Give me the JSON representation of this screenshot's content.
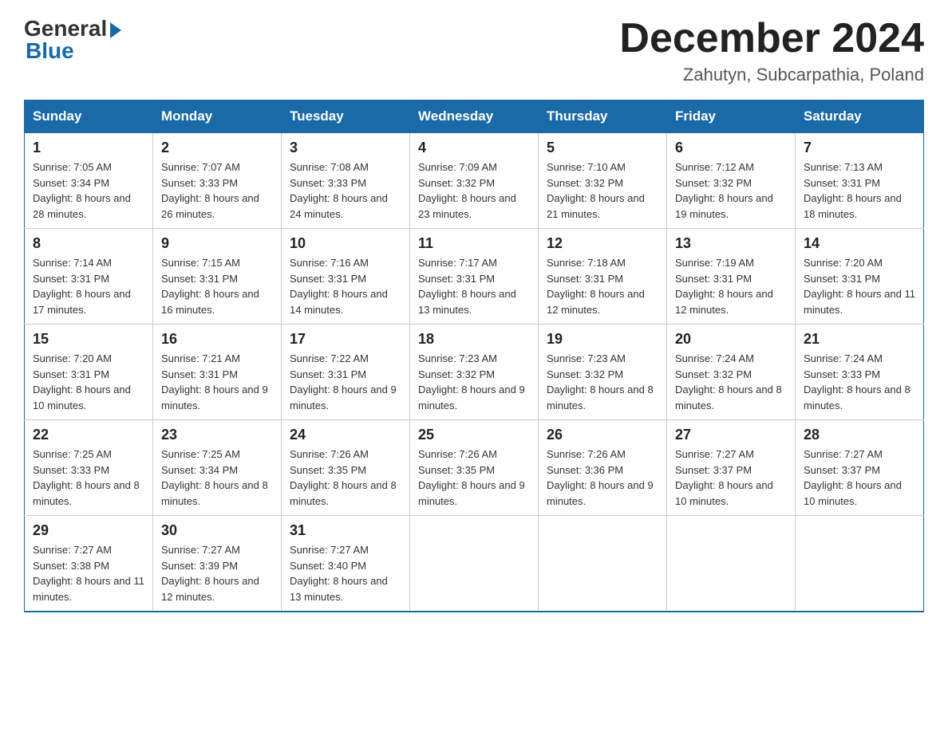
{
  "header": {
    "logo": {
      "general": "General",
      "blue": "Blue"
    },
    "title": "December 2024",
    "location": "Zahutyn, Subcarpathia, Poland"
  },
  "days_of_week": [
    "Sunday",
    "Monday",
    "Tuesday",
    "Wednesday",
    "Thursday",
    "Friday",
    "Saturday"
  ],
  "weeks": [
    [
      {
        "day": "1",
        "sunrise": "7:05 AM",
        "sunset": "3:34 PM",
        "daylight": "8 hours and 28 minutes."
      },
      {
        "day": "2",
        "sunrise": "7:07 AM",
        "sunset": "3:33 PM",
        "daylight": "8 hours and 26 minutes."
      },
      {
        "day": "3",
        "sunrise": "7:08 AM",
        "sunset": "3:33 PM",
        "daylight": "8 hours and 24 minutes."
      },
      {
        "day": "4",
        "sunrise": "7:09 AM",
        "sunset": "3:32 PM",
        "daylight": "8 hours and 23 minutes."
      },
      {
        "day": "5",
        "sunrise": "7:10 AM",
        "sunset": "3:32 PM",
        "daylight": "8 hours and 21 minutes."
      },
      {
        "day": "6",
        "sunrise": "7:12 AM",
        "sunset": "3:32 PM",
        "daylight": "8 hours and 19 minutes."
      },
      {
        "day": "7",
        "sunrise": "7:13 AM",
        "sunset": "3:31 PM",
        "daylight": "8 hours and 18 minutes."
      }
    ],
    [
      {
        "day": "8",
        "sunrise": "7:14 AM",
        "sunset": "3:31 PM",
        "daylight": "8 hours and 17 minutes."
      },
      {
        "day": "9",
        "sunrise": "7:15 AM",
        "sunset": "3:31 PM",
        "daylight": "8 hours and 16 minutes."
      },
      {
        "day": "10",
        "sunrise": "7:16 AM",
        "sunset": "3:31 PM",
        "daylight": "8 hours and 14 minutes."
      },
      {
        "day": "11",
        "sunrise": "7:17 AM",
        "sunset": "3:31 PM",
        "daylight": "8 hours and 13 minutes."
      },
      {
        "day": "12",
        "sunrise": "7:18 AM",
        "sunset": "3:31 PM",
        "daylight": "8 hours and 12 minutes."
      },
      {
        "day": "13",
        "sunrise": "7:19 AM",
        "sunset": "3:31 PM",
        "daylight": "8 hours and 12 minutes."
      },
      {
        "day": "14",
        "sunrise": "7:20 AM",
        "sunset": "3:31 PM",
        "daylight": "8 hours and 11 minutes."
      }
    ],
    [
      {
        "day": "15",
        "sunrise": "7:20 AM",
        "sunset": "3:31 PM",
        "daylight": "8 hours and 10 minutes."
      },
      {
        "day": "16",
        "sunrise": "7:21 AM",
        "sunset": "3:31 PM",
        "daylight": "8 hours and 9 minutes."
      },
      {
        "day": "17",
        "sunrise": "7:22 AM",
        "sunset": "3:31 PM",
        "daylight": "8 hours and 9 minutes."
      },
      {
        "day": "18",
        "sunrise": "7:23 AM",
        "sunset": "3:32 PM",
        "daylight": "8 hours and 9 minutes."
      },
      {
        "day": "19",
        "sunrise": "7:23 AM",
        "sunset": "3:32 PM",
        "daylight": "8 hours and 8 minutes."
      },
      {
        "day": "20",
        "sunrise": "7:24 AM",
        "sunset": "3:32 PM",
        "daylight": "8 hours and 8 minutes."
      },
      {
        "day": "21",
        "sunrise": "7:24 AM",
        "sunset": "3:33 PM",
        "daylight": "8 hours and 8 minutes."
      }
    ],
    [
      {
        "day": "22",
        "sunrise": "7:25 AM",
        "sunset": "3:33 PM",
        "daylight": "8 hours and 8 minutes."
      },
      {
        "day": "23",
        "sunrise": "7:25 AM",
        "sunset": "3:34 PM",
        "daylight": "8 hours and 8 minutes."
      },
      {
        "day": "24",
        "sunrise": "7:26 AM",
        "sunset": "3:35 PM",
        "daylight": "8 hours and 8 minutes."
      },
      {
        "day": "25",
        "sunrise": "7:26 AM",
        "sunset": "3:35 PM",
        "daylight": "8 hours and 9 minutes."
      },
      {
        "day": "26",
        "sunrise": "7:26 AM",
        "sunset": "3:36 PM",
        "daylight": "8 hours and 9 minutes."
      },
      {
        "day": "27",
        "sunrise": "7:27 AM",
        "sunset": "3:37 PM",
        "daylight": "8 hours and 10 minutes."
      },
      {
        "day": "28",
        "sunrise": "7:27 AM",
        "sunset": "3:37 PM",
        "daylight": "8 hours and 10 minutes."
      }
    ],
    [
      {
        "day": "29",
        "sunrise": "7:27 AM",
        "sunset": "3:38 PM",
        "daylight": "8 hours and 11 minutes."
      },
      {
        "day": "30",
        "sunrise": "7:27 AM",
        "sunset": "3:39 PM",
        "daylight": "8 hours and 12 minutes."
      },
      {
        "day": "31",
        "sunrise": "7:27 AM",
        "sunset": "3:40 PM",
        "daylight": "8 hours and 13 minutes."
      },
      null,
      null,
      null,
      null
    ]
  ]
}
